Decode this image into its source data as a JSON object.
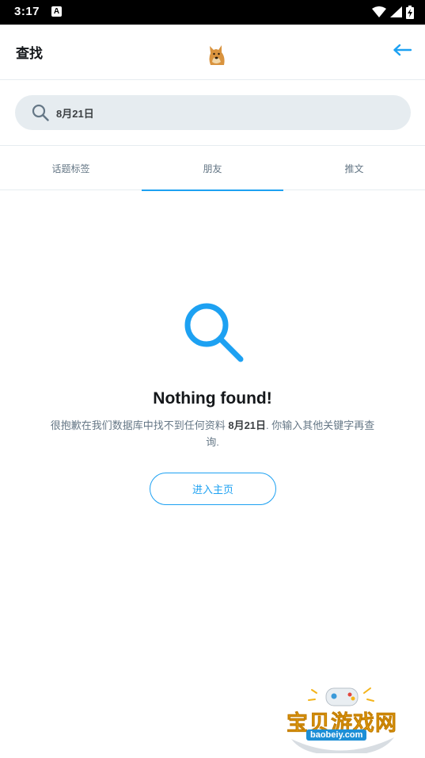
{
  "status_bar": {
    "time": "3:17",
    "notification_badge": "A",
    "icons": [
      "wifi-icon",
      "signal-icon",
      "battery-charging-icon"
    ]
  },
  "header": {
    "title": "查找",
    "avatar": "doge-avatar",
    "back_icon": "arrow-left-icon"
  },
  "search": {
    "icon": "search-icon",
    "value": "8月21日"
  },
  "tabs": [
    {
      "label": "话题标签",
      "active": false
    },
    {
      "label": "朋友",
      "active": true
    },
    {
      "label": "推文",
      "active": false
    }
  ],
  "empty_state": {
    "icon": "magnifier-icon",
    "title": "Nothing found!",
    "desc_prefix": "很抱歉在我们数据库中找不到任何资料 ",
    "desc_query": "8月21日",
    "desc_suffix": ". 你输入其他关键字再查询.",
    "button_label": "进入主页"
  },
  "watermark": {
    "text": "宝贝游戏网",
    "url": "baobeiy.com"
  },
  "colors": {
    "accent": "#1da1f2",
    "text_primary": "#14171a",
    "text_secondary": "#657786",
    "search_bg": "#e6ecf0",
    "divider": "#e6ecf0"
  }
}
